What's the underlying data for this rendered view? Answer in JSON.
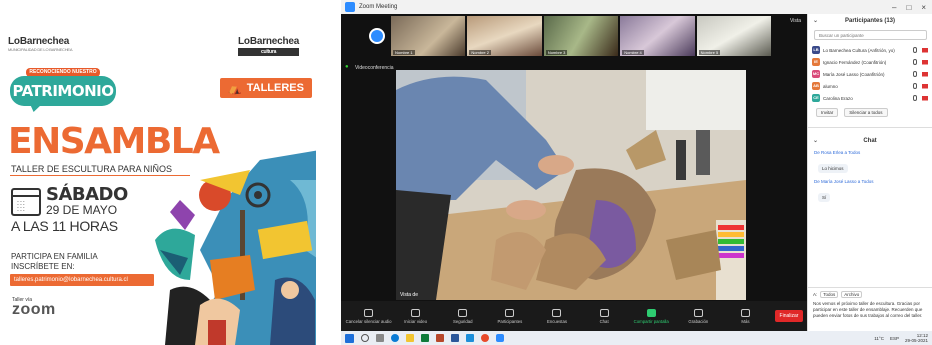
{
  "poster": {
    "brand_left": "LoBarnechea",
    "brand_left_sub": "MUNICIPALIDAD DE LO BARNECHEA",
    "brand_right": "LoBarnechea",
    "brand_right_tag": "cultura",
    "badge_top": "RECONOCIENDO NUESTRO",
    "badge_main": "PATRIMONIO",
    "talleres": "TALLERES",
    "title": "ENSAMBLA",
    "subtitle": "TALLER DE ESCULTURA PARA NIÑOS",
    "day": "SÁBADO",
    "date": "29 DE MAYO",
    "time": "A LAS 11 HORAS",
    "participa_line1": "PARTICIPA EN FAMILIA",
    "participa_line2": "INSCRÍBETE EN:",
    "email": "talleres.patrimonio@lobarnechea.cultura.cl",
    "zoom_label": "Taller vía",
    "zoom_logo": "zoom",
    "colors": {
      "accent": "#ec6a33",
      "teal": "#2ea89a"
    }
  },
  "zoom": {
    "window_title": "Zoom Meeting",
    "window_controls": [
      "–",
      "□",
      "×"
    ],
    "view_label": "Vista",
    "security_label": "Videoconferencia",
    "speaker_name": "Vista de",
    "thumbnails": [
      {
        "name": "Nombre 1"
      },
      {
        "name": "Nombre 2"
      },
      {
        "name": "Nombre 3"
      },
      {
        "name": "Nombre 4"
      },
      {
        "name": "Nombre 5"
      }
    ],
    "toolbar": [
      {
        "label": "Cancelar silenciar audio",
        "icon": "mic-icon"
      },
      {
        "label": "Iniciar video",
        "icon": "video-icon"
      },
      {
        "label": "Seguridad",
        "icon": "shield-icon"
      },
      {
        "label": "Participantes",
        "icon": "participants-icon"
      },
      {
        "label": "Encuestas",
        "icon": "poll-icon"
      },
      {
        "label": "Chat",
        "icon": "chat-icon"
      },
      {
        "label": "Compartir pantalla",
        "icon": "share-screen-icon"
      },
      {
        "label": "Grabación",
        "icon": "record-icon"
      },
      {
        "label": "Más",
        "icon": "more-icon"
      }
    ],
    "end_label": "Finalizar",
    "participants": {
      "header": "Participantes (13)",
      "search_placeholder": "Buscar un participante",
      "list": [
        {
          "initials": "LB",
          "name": "Lo Barnechea Cultura (Anfitrión, yo)",
          "color": "#3a4a8a"
        },
        {
          "initials": "IE",
          "name": "Ignacio Fernández (Coanfitrión)",
          "color": "#e4783a"
        },
        {
          "initials": "MC",
          "name": "María José Lasso (Coanfitrión)",
          "color": "#d94a7a"
        },
        {
          "initials": "AB",
          "name": "alumno",
          "color": "#e4783a"
        },
        {
          "initials": "CE",
          "name": "Carolina Erazo",
          "color": "#2ea89a"
        }
      ],
      "invite_label": "Invitar",
      "mute_all_label": "Silenciar a todos"
    },
    "chat": {
      "header": "Chat",
      "msg1_from": "De Rosa Erlea a Todos",
      "msg1_text": "Lo hicimos",
      "msg2_from": "De María José Lasso a Todos",
      "msg2_text": "Sí",
      "to_label": "A:",
      "to_value": "Todos",
      "file_label": "Archivo",
      "input_text": "Nos vemos el próximo taller de escultura. Gracias por participar en este taller de ensamblaje. Recuerden que pueden enviar fotos de sus trabajos al correo del taller."
    },
    "taskbar": {
      "weather": "11°C",
      "language": "ESP",
      "time": "12:12",
      "date": "29-05-2021"
    }
  }
}
